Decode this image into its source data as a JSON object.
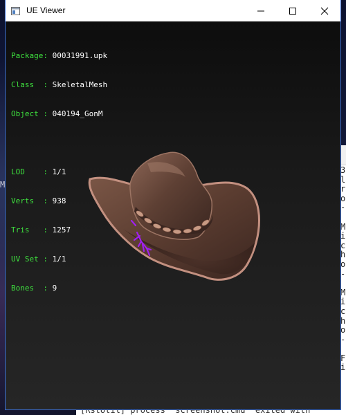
{
  "window": {
    "title": "UE Viewer",
    "icon": "app-window-icon",
    "controls": [
      "minimize-icon",
      "maximize-icon",
      "close-icon"
    ]
  },
  "info": {
    "package": {
      "label": "Package:",
      "value": "00031991.upk"
    },
    "class": {
      "label": "Class  :",
      "value": "SkeletalMesh"
    },
    "object": {
      "label": "Object :",
      "value": "040194_GonM"
    },
    "lod": {
      "label": "LOD    :",
      "value": "1/1"
    },
    "verts": {
      "label": "Verts  :",
      "value": "938"
    },
    "tris": {
      "label": "Tris   :",
      "value": "1257"
    },
    "uvset": {
      "label": "UV Set :",
      "value": "1/1"
    },
    "bones": {
      "label": "Bones  :",
      "value": "9"
    }
  },
  "background": {
    "desktop_glyph": "M",
    "console_lines": [
      "3",
      "l",
      "r",
      "o",
      "-",
      "",
      "M",
      "i",
      "c",
      "h",
      "o",
      "-",
      "",
      "M",
      "i",
      "c",
      "h",
      "o",
      "-",
      "",
      "F",
      "i"
    ],
    "bottom_text": "[RstUtil] process \"screenshot.cmd\" exited with"
  },
  "colors": {
    "info_label": "#3ee03e",
    "info_value": "#ffffff",
    "viewport_bg": "#1a1a1a",
    "hat_leather": "#6b4a3a",
    "bones_overlay": "#a020f0"
  }
}
